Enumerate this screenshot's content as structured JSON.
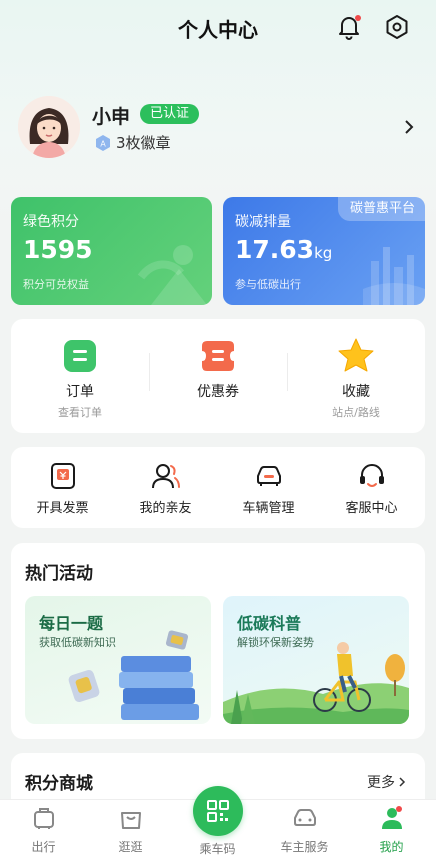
{
  "header": {
    "title": "个人中心"
  },
  "profile": {
    "name": "小申",
    "verified_label": "已认证",
    "badges": "3枚徽章"
  },
  "green_card": {
    "label": "绿色积分",
    "value": "1595",
    "sub": "积分可兑权益"
  },
  "blue_card": {
    "label": "碳减排量",
    "value": "17.63",
    "unit": "kg",
    "sub": "参与低碳出行",
    "tag": "碳普惠平台"
  },
  "orders": [
    {
      "label": "订单",
      "sub": "查看订单"
    },
    {
      "label": "优惠券",
      "sub": ""
    },
    {
      "label": "收藏",
      "sub": "站点/路线"
    }
  ],
  "services": [
    {
      "label": "开具发票"
    },
    {
      "label": "我的亲友"
    },
    {
      "label": "车辆管理"
    },
    {
      "label": "客服中心"
    }
  ],
  "activities": {
    "title": "热门活动",
    "items": [
      {
        "title": "每日一题",
        "sub": "获取低碳新知识"
      },
      {
        "title": "低碳科普",
        "sub": "解锁环保新姿势"
      }
    ]
  },
  "shop": {
    "title": "积分商城",
    "more": "更多"
  },
  "tabbar": [
    {
      "label": "出行"
    },
    {
      "label": "逛逛"
    },
    {
      "label": "乘车码"
    },
    {
      "label": "车主服务"
    },
    {
      "label": "我的"
    }
  ],
  "colors": {
    "brand_green": "#2dbb5b",
    "card_blue": "#3d79e8",
    "accent_red": "#f04a4a"
  }
}
